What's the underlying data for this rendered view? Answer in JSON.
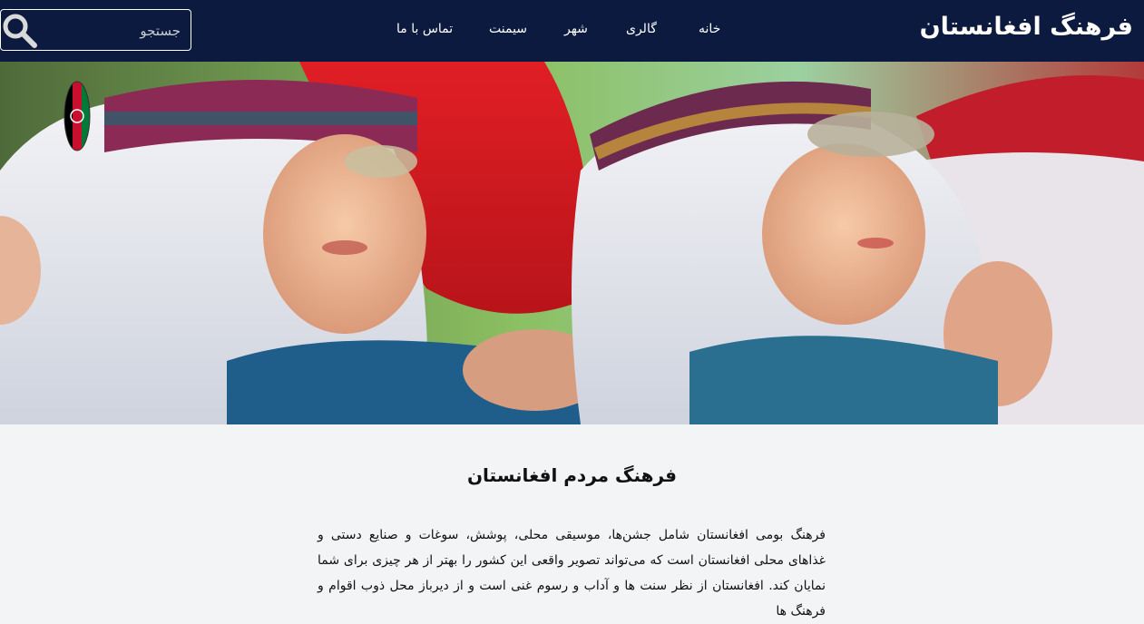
{
  "header": {
    "brand": "فرهنگ افغانستان",
    "nav": [
      {
        "label": "خانه"
      },
      {
        "label": "گالری"
      },
      {
        "label": "شهر"
      },
      {
        "label": "سیمنت"
      },
      {
        "label": "تماس با ما"
      }
    ],
    "search": {
      "placeholder": "جستجو",
      "icon": "search-icon"
    }
  },
  "hero": {
    "emblem_icon": "afghan-flag-emblem"
  },
  "main": {
    "title": "فرهنگ مردم افغانستان",
    "paragraph": "فرهنگ بومی افغانستان شامل جشن‌ها، موسیقی محلی، پوشش، سوغات و صنایع دستی و غذاهای محلی افغانستان است که می‌تواند تصویر واقعی این کشور را بهتر از هر چیزی برای شما نمایان کند. افغانستان از نظر سنت ها و آداب و رسوم غنی است و از دیرباز محل ذوب اقوام و فرهنگ ها"
  },
  "colors": {
    "navbar_bg": "#0b1a3e",
    "content_bg": "#f3f4f6"
  }
}
